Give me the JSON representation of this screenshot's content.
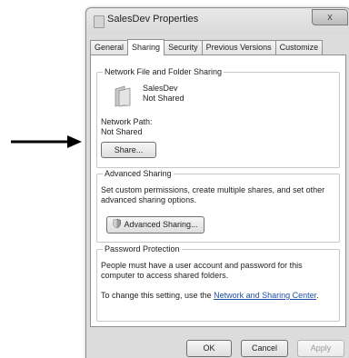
{
  "window": {
    "title": "SalesDev Properties",
    "close_label": "x"
  },
  "tabs": [
    {
      "label": "General",
      "active": false
    },
    {
      "label": "Sharing",
      "active": true
    },
    {
      "label": "Security",
      "active": false
    },
    {
      "label": "Previous Versions",
      "active": false
    },
    {
      "label": "Customize",
      "active": false
    }
  ],
  "network_sharing": {
    "group_title": "Network File and Folder Sharing",
    "folder_name": "SalesDev",
    "share_status": "Not Shared",
    "network_path_label": "Network Path:",
    "network_path_value": "Not Shared",
    "share_button": "Share..."
  },
  "advanced_sharing": {
    "group_title": "Advanced Sharing",
    "description": "Set custom permissions, create multiple shares, and set other advanced sharing options.",
    "button": "Advanced Sharing..."
  },
  "password_protection": {
    "group_title": "Password Protection",
    "description": "People must have a user account and password for this computer to access shared folders.",
    "change_prefix": "To change this setting, use the ",
    "link_text": "Network and Sharing Center",
    "change_suffix": "."
  },
  "buttons": {
    "ok": "OK",
    "cancel": "Cancel",
    "apply": "Apply"
  },
  "icons": {
    "folder": "folder-icon",
    "shield": "shield-icon",
    "arrow": "arrow-pointer-icon"
  },
  "colors": {
    "link": "#1e4fa3",
    "disabled_text": "#9a9a9a"
  }
}
